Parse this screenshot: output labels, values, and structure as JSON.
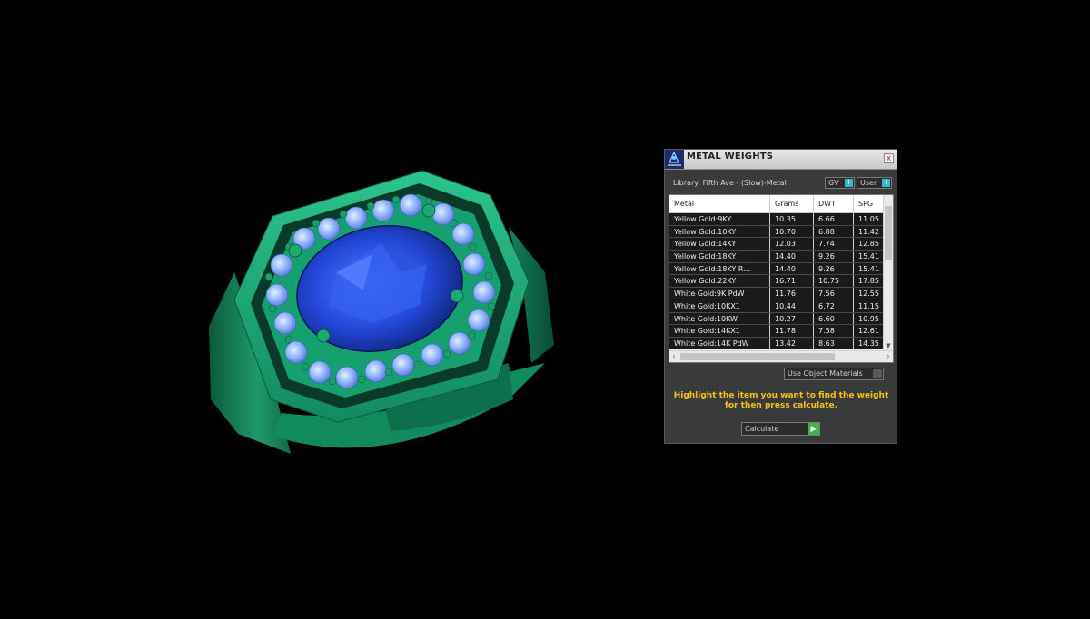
{
  "panel": {
    "title": "METAL WEIGHTS",
    "close_glyph": "x",
    "library_label": "Library: Fifth Ave - (Slow)-Metal",
    "gv_button": "GV",
    "gv_indicator": "I",
    "user_button": "User",
    "user_indicator": "I",
    "columns": [
      "Metal",
      "Grams",
      "DWT",
      "SPG"
    ],
    "rows": [
      [
        "Yellow Gold:9KY",
        "10.35",
        "6.66",
        "11.05"
      ],
      [
        "Yellow Gold:10KY",
        "10.70",
        "6.88",
        "11.42"
      ],
      [
        "Yellow Gold:14KY",
        "12.03",
        "7.74",
        "12.85"
      ],
      [
        "Yellow Gold:18KY",
        "14.40",
        "9.26",
        "15.41"
      ],
      [
        "Yellow Gold:18KY R…",
        "14.40",
        "9.26",
        "15.41"
      ],
      [
        "Yellow Gold:22KY",
        "16.71",
        "10.75",
        "17.85"
      ],
      [
        "White Gold:9K PdW",
        "11.76",
        "7.56",
        "12.55"
      ],
      [
        "White Gold:10KX1",
        "10.44",
        "6.72",
        "11.15"
      ],
      [
        "White Gold:10KW",
        "10.27",
        "6.60",
        "10.95"
      ],
      [
        "White Gold:14KX1",
        "11.78",
        "7.58",
        "12.61"
      ],
      [
        "White Gold:14K PdW",
        "13.42",
        "8.63",
        "14.35"
      ]
    ],
    "use_materials_label": "Use Object Materials",
    "instruction_line1": "Highlight the item you want to find the weight",
    "instruction_line2": "for then press calculate.",
    "calculate_label": "Calculate",
    "calculate_icon": "▶"
  },
  "icons": {
    "app": "gem-scale-icon",
    "close": "close-icon",
    "scroll_up": "chevron-up-icon",
    "scroll_down": "chevron-down-icon",
    "scroll_left": "chevron-left-icon",
    "scroll_right": "chevron-right-icon"
  },
  "colors": {
    "background": "#000000",
    "ring_metal": "#1fa876",
    "center_stone": "#1b3fd6",
    "side_stones": "#8fb7ff",
    "panel_bg": "#3a3a3a",
    "instruction_text": "#f0c419",
    "accent_indicator": "#3ab7c8",
    "go_button": "#3bb54a"
  }
}
